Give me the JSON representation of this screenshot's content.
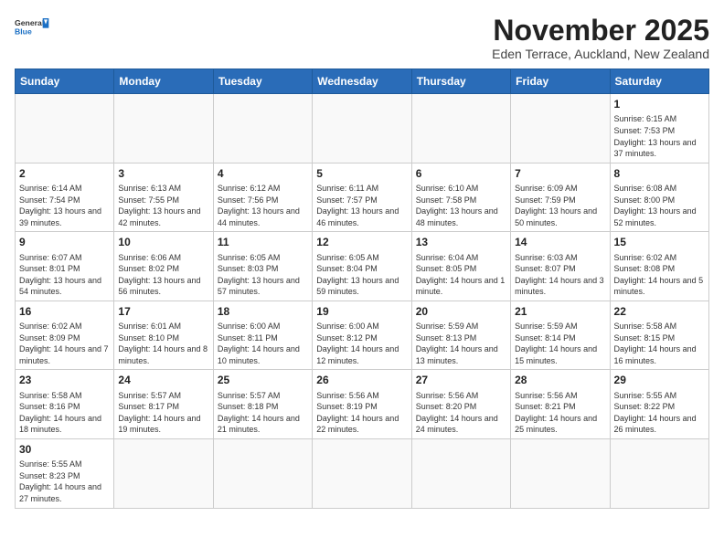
{
  "logo": {
    "line1": "General",
    "line2": "Blue"
  },
  "title": "November 2025",
  "location": "Eden Terrace, Auckland, New Zealand",
  "weekdays": [
    "Sunday",
    "Monday",
    "Tuesday",
    "Wednesday",
    "Thursday",
    "Friday",
    "Saturday"
  ],
  "weeks": [
    [
      {
        "day": "",
        "info": ""
      },
      {
        "day": "",
        "info": ""
      },
      {
        "day": "",
        "info": ""
      },
      {
        "day": "",
        "info": ""
      },
      {
        "day": "",
        "info": ""
      },
      {
        "day": "",
        "info": ""
      },
      {
        "day": "1",
        "info": "Sunrise: 6:15 AM\nSunset: 7:53 PM\nDaylight: 13 hours and 37 minutes."
      }
    ],
    [
      {
        "day": "2",
        "info": "Sunrise: 6:14 AM\nSunset: 7:54 PM\nDaylight: 13 hours and 39 minutes."
      },
      {
        "day": "3",
        "info": "Sunrise: 6:13 AM\nSunset: 7:55 PM\nDaylight: 13 hours and 42 minutes."
      },
      {
        "day": "4",
        "info": "Sunrise: 6:12 AM\nSunset: 7:56 PM\nDaylight: 13 hours and 44 minutes."
      },
      {
        "day": "5",
        "info": "Sunrise: 6:11 AM\nSunset: 7:57 PM\nDaylight: 13 hours and 46 minutes."
      },
      {
        "day": "6",
        "info": "Sunrise: 6:10 AM\nSunset: 7:58 PM\nDaylight: 13 hours and 48 minutes."
      },
      {
        "day": "7",
        "info": "Sunrise: 6:09 AM\nSunset: 7:59 PM\nDaylight: 13 hours and 50 minutes."
      },
      {
        "day": "8",
        "info": "Sunrise: 6:08 AM\nSunset: 8:00 PM\nDaylight: 13 hours and 52 minutes."
      }
    ],
    [
      {
        "day": "9",
        "info": "Sunrise: 6:07 AM\nSunset: 8:01 PM\nDaylight: 13 hours and 54 minutes."
      },
      {
        "day": "10",
        "info": "Sunrise: 6:06 AM\nSunset: 8:02 PM\nDaylight: 13 hours and 56 minutes."
      },
      {
        "day": "11",
        "info": "Sunrise: 6:05 AM\nSunset: 8:03 PM\nDaylight: 13 hours and 57 minutes."
      },
      {
        "day": "12",
        "info": "Sunrise: 6:05 AM\nSunset: 8:04 PM\nDaylight: 13 hours and 59 minutes."
      },
      {
        "day": "13",
        "info": "Sunrise: 6:04 AM\nSunset: 8:05 PM\nDaylight: 14 hours and 1 minute."
      },
      {
        "day": "14",
        "info": "Sunrise: 6:03 AM\nSunset: 8:07 PM\nDaylight: 14 hours and 3 minutes."
      },
      {
        "day": "15",
        "info": "Sunrise: 6:02 AM\nSunset: 8:08 PM\nDaylight: 14 hours and 5 minutes."
      }
    ],
    [
      {
        "day": "16",
        "info": "Sunrise: 6:02 AM\nSunset: 8:09 PM\nDaylight: 14 hours and 7 minutes."
      },
      {
        "day": "17",
        "info": "Sunrise: 6:01 AM\nSunset: 8:10 PM\nDaylight: 14 hours and 8 minutes."
      },
      {
        "day": "18",
        "info": "Sunrise: 6:00 AM\nSunset: 8:11 PM\nDaylight: 14 hours and 10 minutes."
      },
      {
        "day": "19",
        "info": "Sunrise: 6:00 AM\nSunset: 8:12 PM\nDaylight: 14 hours and 12 minutes."
      },
      {
        "day": "20",
        "info": "Sunrise: 5:59 AM\nSunset: 8:13 PM\nDaylight: 14 hours and 13 minutes."
      },
      {
        "day": "21",
        "info": "Sunrise: 5:59 AM\nSunset: 8:14 PM\nDaylight: 14 hours and 15 minutes."
      },
      {
        "day": "22",
        "info": "Sunrise: 5:58 AM\nSunset: 8:15 PM\nDaylight: 14 hours and 16 minutes."
      }
    ],
    [
      {
        "day": "23",
        "info": "Sunrise: 5:58 AM\nSunset: 8:16 PM\nDaylight: 14 hours and 18 minutes."
      },
      {
        "day": "24",
        "info": "Sunrise: 5:57 AM\nSunset: 8:17 PM\nDaylight: 14 hours and 19 minutes."
      },
      {
        "day": "25",
        "info": "Sunrise: 5:57 AM\nSunset: 8:18 PM\nDaylight: 14 hours and 21 minutes."
      },
      {
        "day": "26",
        "info": "Sunrise: 5:56 AM\nSunset: 8:19 PM\nDaylight: 14 hours and 22 minutes."
      },
      {
        "day": "27",
        "info": "Sunrise: 5:56 AM\nSunset: 8:20 PM\nDaylight: 14 hours and 24 minutes."
      },
      {
        "day": "28",
        "info": "Sunrise: 5:56 AM\nSunset: 8:21 PM\nDaylight: 14 hours and 25 minutes."
      },
      {
        "day": "29",
        "info": "Sunrise: 5:55 AM\nSunset: 8:22 PM\nDaylight: 14 hours and 26 minutes."
      }
    ],
    [
      {
        "day": "30",
        "info": "Sunrise: 5:55 AM\nSunset: 8:23 PM\nDaylight: 14 hours and 27 minutes."
      },
      {
        "day": "",
        "info": ""
      },
      {
        "day": "",
        "info": ""
      },
      {
        "day": "",
        "info": ""
      },
      {
        "day": "",
        "info": ""
      },
      {
        "day": "",
        "info": ""
      },
      {
        "day": "",
        "info": ""
      }
    ]
  ]
}
